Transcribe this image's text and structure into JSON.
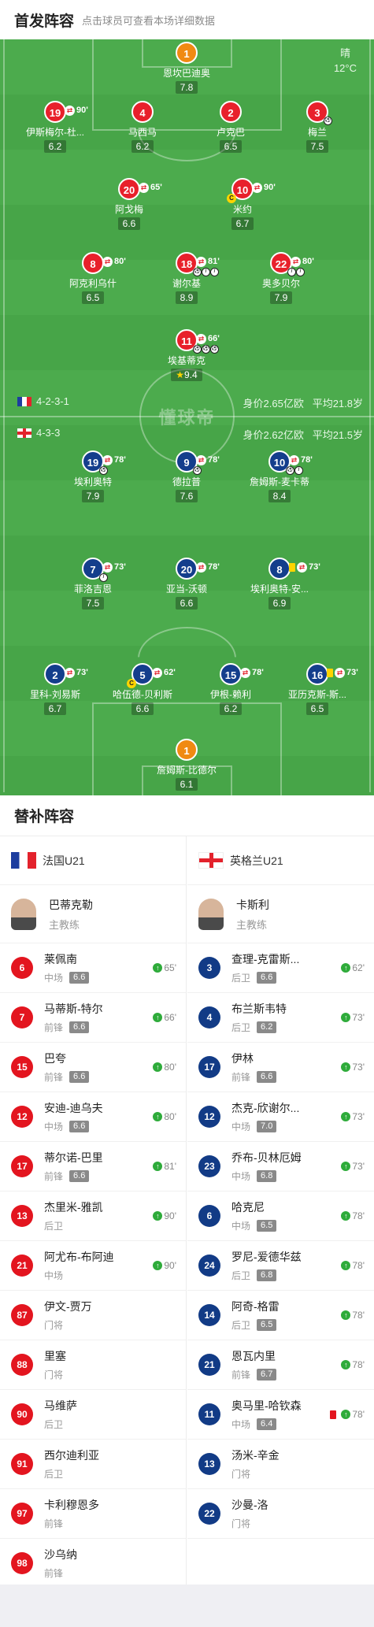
{
  "header": {
    "title": "首发阵容",
    "subtitle": "点击球员可查看本场详细数据"
  },
  "weather": {
    "condition": "晴",
    "temp": "12°C"
  },
  "watermark": "懂球帝",
  "france": {
    "formation": "4-2-3-1",
    "value": "身价2.65亿欧",
    "age": "平均21.8岁"
  },
  "england": {
    "formation": "4-3-3",
    "value": "身价2.62亿欧",
    "age": "平均21.5岁"
  },
  "pitch_players": {
    "fr_gk": {
      "num": "1",
      "name": "恩坎巴迪奥",
      "rating": "7.8"
    },
    "fr_lb": {
      "num": "19",
      "name": "伊斯梅尔-杜...",
      "rating": "6.2",
      "sub": "90'"
    },
    "fr_cb1": {
      "num": "4",
      "name": "马西马",
      "rating": "6.2"
    },
    "fr_cb2": {
      "num": "2",
      "name": "卢克巴",
      "rating": "6.5"
    },
    "fr_rb": {
      "num": "3",
      "name": "梅兰",
      "rating": "7.5"
    },
    "fr_dm1": {
      "num": "20",
      "name": "阿戈梅",
      "rating": "6.6",
      "sub": "65'"
    },
    "fr_dm2": {
      "num": "10",
      "name": "米约",
      "rating": "6.7",
      "sub": "90'"
    },
    "fr_am1": {
      "num": "8",
      "name": "阿克利乌什",
      "rating": "6.5",
      "sub": "80'"
    },
    "fr_am2": {
      "num": "18",
      "name": "谢尔基",
      "rating": "8.9",
      "sub": "81'"
    },
    "fr_am3": {
      "num": "22",
      "name": "奥多贝尔",
      "rating": "7.9",
      "sub": "80'"
    },
    "fr_st": {
      "num": "11",
      "name": "埃基蒂克",
      "rating": "9.4",
      "sub": "66'"
    },
    "en_lw": {
      "num": "19",
      "name": "埃利奥特",
      "rating": "7.9",
      "sub": "78'"
    },
    "en_st": {
      "num": "9",
      "name": "德拉普",
      "rating": "7.6",
      "sub": "78'"
    },
    "en_rw": {
      "num": "10",
      "name": "詹姆斯-麦卡蒂",
      "rating": "8.4",
      "sub": "78'"
    },
    "en_cm1": {
      "num": "7",
      "name": "菲洛吉恩",
      "rating": "7.5",
      "sub": "73'"
    },
    "en_cm2": {
      "num": "20",
      "name": "亚当-沃顿",
      "rating": "6.6",
      "sub": "78'"
    },
    "en_cm3": {
      "num": "8",
      "name": "埃利奥特-安...",
      "rating": "6.9",
      "sub": "73'"
    },
    "en_lb": {
      "num": "2",
      "name": "里科-刘易斯",
      "rating": "6.7",
      "sub": "73'"
    },
    "en_cb1": {
      "num": "5",
      "name": "哈伍德-贝利斯",
      "rating": "6.6",
      "sub": "62'"
    },
    "en_cb2": {
      "num": "15",
      "name": "伊根-赖利",
      "rating": "6.2",
      "sub": "78'"
    },
    "en_rb": {
      "num": "16",
      "name": "亚历克斯-斯...",
      "rating": "6.5",
      "sub": "73'"
    },
    "en_gk": {
      "num": "1",
      "name": "詹姆斯-比德尔",
      "rating": "6.1"
    }
  },
  "subs_title": "替补阵容",
  "left_team": {
    "name": "法国U21",
    "coach": {
      "name": "巴蒂克勒",
      "role": "主教练"
    },
    "players": [
      {
        "num": "6",
        "name": "莱佩南",
        "pos": "中场",
        "rating": "6.6",
        "in": "65'"
      },
      {
        "num": "7",
        "name": "马蒂斯-特尔",
        "pos": "前锋",
        "rating": "6.6",
        "in": "66'"
      },
      {
        "num": "15",
        "name": "巴夸",
        "pos": "前锋",
        "rating": "6.6",
        "in": "80'"
      },
      {
        "num": "12",
        "name": "安迪-迪乌夫",
        "pos": "中场",
        "rating": "6.6",
        "in": "80'"
      },
      {
        "num": "17",
        "name": "蒂尔诺-巴里",
        "pos": "前锋",
        "rating": "6.6",
        "in": "81'"
      },
      {
        "num": "13",
        "name": "杰里米-雅凯",
        "pos": "后卫",
        "rating": "",
        "in": "90'"
      },
      {
        "num": "21",
        "name": "阿尤布-布阿迪",
        "pos": "中场",
        "rating": "",
        "in": "90'"
      },
      {
        "num": "87",
        "name": "伊文-贾万",
        "pos": "门将",
        "rating": "",
        "in": ""
      },
      {
        "num": "88",
        "name": "里塞",
        "pos": "门将",
        "rating": "",
        "in": ""
      },
      {
        "num": "90",
        "name": "马维萨",
        "pos": "后卫",
        "rating": "",
        "in": ""
      },
      {
        "num": "91",
        "name": "西尔迪利亚",
        "pos": "后卫",
        "rating": "",
        "in": ""
      },
      {
        "num": "97",
        "name": "卡利穆恩多",
        "pos": "前锋",
        "rating": "",
        "in": ""
      },
      {
        "num": "98",
        "name": "沙乌纳",
        "pos": "前锋",
        "rating": "",
        "in": ""
      }
    ]
  },
  "right_team": {
    "name": "英格兰U21",
    "coach": {
      "name": "卡斯利",
      "role": "主教练"
    },
    "players": [
      {
        "num": "3",
        "name": "查理-克雷斯...",
        "pos": "后卫",
        "rating": "6.6",
        "in": "62'"
      },
      {
        "num": "4",
        "name": "布兰斯韦特",
        "pos": "后卫",
        "rating": "6.2",
        "in": "73'"
      },
      {
        "num": "17",
        "name": "伊林",
        "pos": "前锋",
        "rating": "6.6",
        "in": "73'"
      },
      {
        "num": "12",
        "name": "杰克-欣谢尔...",
        "pos": "中场",
        "rating": "7.0",
        "in": "73'"
      },
      {
        "num": "23",
        "name": "乔布-贝林厄姆",
        "pos": "中场",
        "rating": "6.8",
        "in": "73'"
      },
      {
        "num": "6",
        "name": "哈克尼",
        "pos": "中场",
        "rating": "6.5",
        "in": "78'"
      },
      {
        "num": "24",
        "name": "罗尼-爱德华兹",
        "pos": "后卫",
        "rating": "6.8",
        "in": "78'"
      },
      {
        "num": "14",
        "name": "阿奇-格雷",
        "pos": "后卫",
        "rating": "6.5",
        "in": "78'"
      },
      {
        "num": "21",
        "name": "恩瓦内里",
        "pos": "前锋",
        "rating": "6.7",
        "in": "78'"
      },
      {
        "num": "11",
        "name": "奥马里-哈钦森",
        "pos": "中场",
        "rating": "6.4",
        "in": "78'"
      },
      {
        "num": "13",
        "name": "汤米-辛金",
        "pos": "门将",
        "rating": "",
        "in": ""
      },
      {
        "num": "22",
        "name": "沙曼-洛",
        "pos": "门将",
        "rating": "",
        "in": ""
      }
    ]
  }
}
